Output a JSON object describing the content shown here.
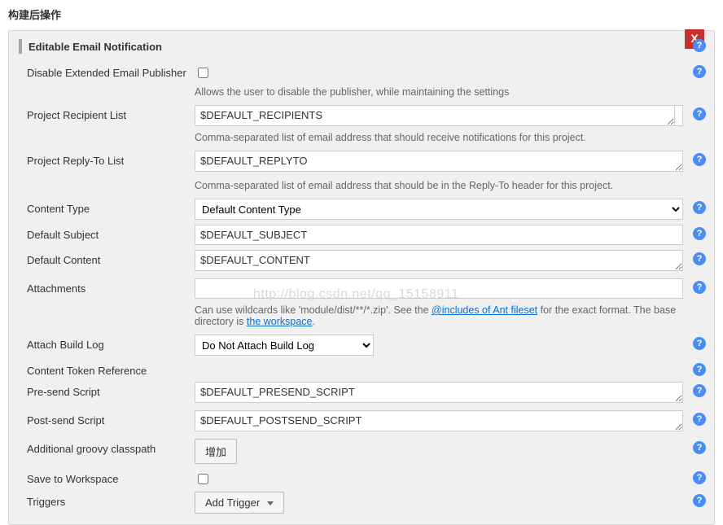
{
  "page": {
    "title": "构建后操作"
  },
  "section": {
    "title": "Editable Email Notification"
  },
  "close": {
    "label": "X"
  },
  "fields": {
    "disablePublisher": {
      "label": "Disable Extended Email Publisher",
      "desc": "Allows the user to disable the publisher, while maintaining the settings"
    },
    "recipientList": {
      "label": "Project Recipient List",
      "value": "$DEFAULT_RECIPIENTS",
      "desc": "Comma-separated list of email address that should receive notifications for this project."
    },
    "replyTo": {
      "label": "Project Reply-To List",
      "value": "$DEFAULT_REPLYTO",
      "desc": "Comma-separated list of email address that should be in the Reply-To header for this project."
    },
    "contentType": {
      "label": "Content Type",
      "value": "Default Content Type"
    },
    "defaultSubject": {
      "label": "Default Subject",
      "value": "$DEFAULT_SUBJECT"
    },
    "defaultContent": {
      "label": "Default Content",
      "value": "$DEFAULT_CONTENT"
    },
    "attachments": {
      "label": "Attachments",
      "value": "",
      "desc_pre": "Can use wildcards like 'module/dist/**/*.zip'. See the ",
      "desc_link1": "@includes of Ant fileset",
      "desc_mid": " for the exact format. The base directory is ",
      "desc_link2": "the workspace",
      "desc_post": "."
    },
    "attachBuildLog": {
      "label": "Attach Build Log",
      "value": "Do Not Attach Build Log"
    },
    "tokenRef": {
      "label": "Content Token Reference"
    },
    "preSend": {
      "label": "Pre-send Script",
      "value": "$DEFAULT_PRESEND_SCRIPT"
    },
    "postSend": {
      "label": "Post-send Script",
      "value": "$DEFAULT_POSTSEND_SCRIPT"
    },
    "classpath": {
      "label": "Additional groovy classpath",
      "button": "增加"
    },
    "saveWorkspace": {
      "label": "Save to Workspace"
    },
    "triggers": {
      "label": "Triggers",
      "button": "Add Trigger"
    }
  },
  "watermark": "http://blog.csdn.net/qq_15158911"
}
